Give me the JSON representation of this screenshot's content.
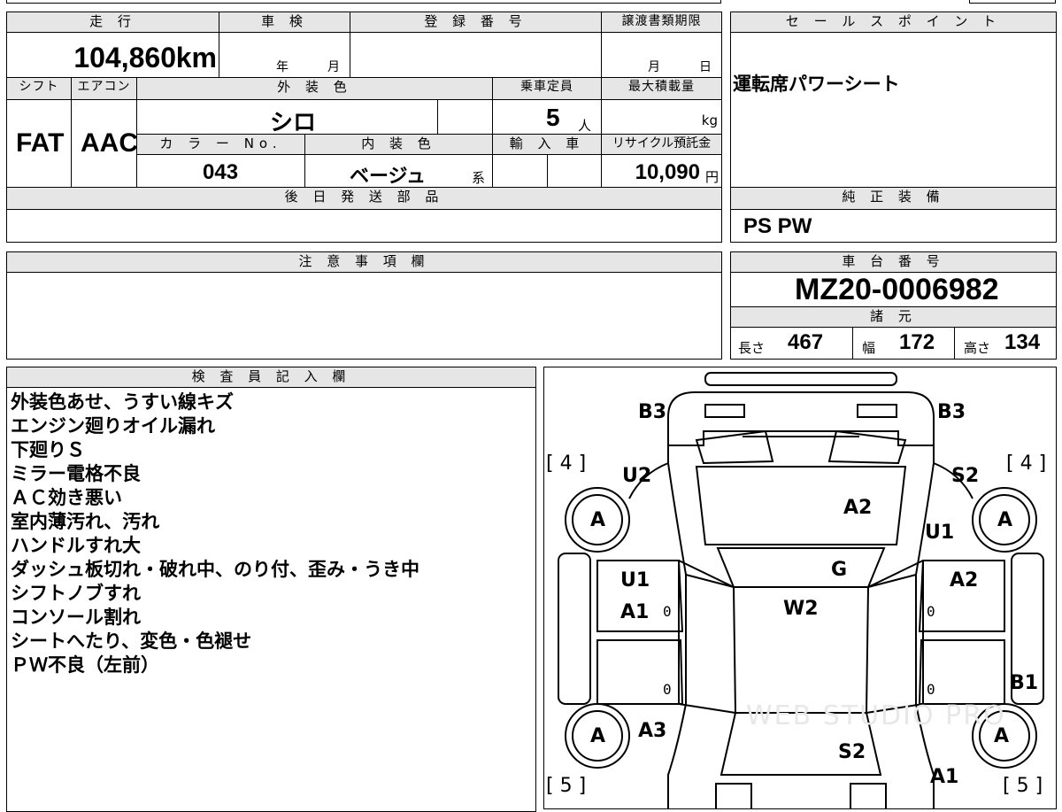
{
  "top": {
    "mileage_header": "走 行",
    "mileage_value": "104,860",
    "mileage_unit": "km",
    "inspection_header": "車 検",
    "inspection_year": "年",
    "inspection_month": "月",
    "registration_header": "登 録 番 号",
    "transfer_header": "譲渡書類期限",
    "transfer_month": "月",
    "transfer_day": "日"
  },
  "row2": {
    "shift_header": "シフト",
    "ac_header": "エアコン",
    "exterior_header": "外 装 色",
    "capacity_header": "乗車定員",
    "load_header": "最大積載量",
    "shift_value": "FAT",
    "ac_value": "AAC",
    "exterior_value": "シロ",
    "capacity_value": "5",
    "capacity_unit": "人",
    "load_unit": "kg",
    "color_no_header": "カ ラ ー No.",
    "interior_header": "内 装 色",
    "import_header": "輸 入 車",
    "recycle_header": "リサイクル預託金",
    "color_no_value": "043",
    "interior_value": "ベージュ",
    "interior_suffix": "系",
    "recycle_value": "10,090",
    "recycle_unit": "円"
  },
  "later_parts_header": "後 日 発 送 部 品",
  "caution_header": "注 意 事 項 欄",
  "sales_point_header": "セ ー ル ス ポ イ ン ト",
  "sales_point_value": "運転席パワーシート",
  "genuine_header": "純 正 装 備",
  "genuine_value": "PS PW",
  "chassis_header": "車 台 番 号",
  "chassis_value": "MZ20-0006982",
  "specs_header": "諸 元",
  "specs": {
    "length_label": "長さ",
    "length_value": "467",
    "width_label": "幅",
    "width_value": "172",
    "height_label": "高さ",
    "height_value": "134"
  },
  "inspector_header": "検 査 員 記 入 欄",
  "inspector_notes": [
    "外装色あせ、うすい線キズ",
    "エンジン廻りオイル漏れ",
    "下廻りＳ",
    "ミラー電格不良",
    "ＡＣ効き悪い",
    "室内薄汚れ、汚れ",
    "ハンドルすれ大",
    "ダッシュ板切れ・破れ中、のり付、歪み・うき中",
    "シフトノブすれ",
    "コンソール割れ",
    "シートへたり、変色・色褪せ",
    "ＰＷ不良（左前）"
  ],
  "diagram": {
    "b3_left": "B3",
    "b3_right": "B3",
    "tire_fl": "[ 4 ]",
    "tire_fr": "[ 4 ]",
    "tire_rl": "[ 5 ]",
    "tire_rr": "[ 5 ]",
    "u2": "U2",
    "s2_top": "S2",
    "a2_hood": "A2",
    "u1_right": "U1",
    "wheel_fl": "A",
    "wheel_fr": "A",
    "wheel_rl": "A",
    "wheel_rr": "A",
    "g": "G",
    "u1_left": "U1",
    "a2_right": "A2",
    "a1_left": "A1",
    "w2": "W2",
    "zero1": "0",
    "zero2": "0",
    "zero3": "0",
    "zero4": "0",
    "b1": "B1",
    "a3": "A3",
    "s2_bottom": "S2",
    "a1_bottom": "A1",
    "watermark": "WEB STUDIO PRO"
  }
}
